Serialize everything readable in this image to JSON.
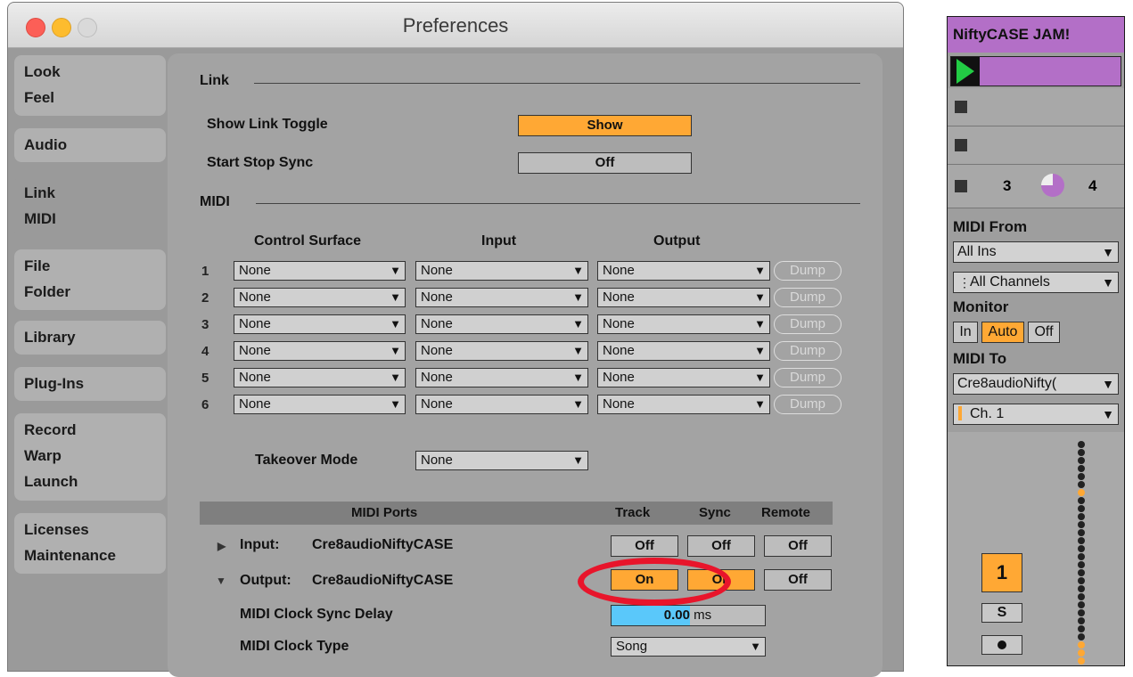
{
  "window": {
    "title": "Preferences"
  },
  "nav": [
    {
      "lines": [
        "Look",
        "Feel"
      ]
    },
    {
      "lines": [
        "Audio"
      ]
    },
    {
      "lines": [
        "Link",
        "MIDI"
      ]
    },
    {
      "lines": [
        "File",
        "Folder"
      ]
    },
    {
      "lines": [
        "Library"
      ]
    },
    {
      "lines": [
        "Plug-Ins"
      ]
    },
    {
      "lines": [
        "Record",
        "Warp",
        "Launch"
      ]
    },
    {
      "lines": [
        "Licenses",
        "Maintenance"
      ]
    }
  ],
  "link": {
    "section": "Link",
    "show_toggle_label": "Show Link Toggle",
    "show_toggle_value": "Show",
    "start_stop_label": "Start Stop Sync",
    "start_stop_value": "Off"
  },
  "midi": {
    "section": "MIDI",
    "col_control": "Control Surface",
    "col_input": "Input",
    "col_output": "Output",
    "rows": [
      {
        "n": "1",
        "cs": "None",
        "in": "None",
        "out": "None",
        "dump": "Dump"
      },
      {
        "n": "2",
        "cs": "None",
        "in": "None",
        "out": "None",
        "dump": "Dump"
      },
      {
        "n": "3",
        "cs": "None",
        "in": "None",
        "out": "None",
        "dump": "Dump"
      },
      {
        "n": "4",
        "cs": "None",
        "in": "None",
        "out": "None",
        "dump": "Dump"
      },
      {
        "n": "5",
        "cs": "None",
        "in": "None",
        "out": "None",
        "dump": "Dump"
      },
      {
        "n": "6",
        "cs": "None",
        "in": "None",
        "out": "None",
        "dump": "Dump"
      }
    ],
    "takeover_label": "Takeover Mode",
    "takeover_value": "None"
  },
  "ports": {
    "head": "MIDI Ports",
    "track": "Track",
    "sync": "Sync",
    "remote": "Remote",
    "input_label": "Input:",
    "input_name": "Cre8audioNiftyCASE",
    "input_track": "Off",
    "input_sync": "Off",
    "input_remote": "Off",
    "output_label": "Output:",
    "output_name": "Cre8audioNiftyCASE",
    "output_track": "On",
    "output_sync": "On",
    "output_remote": "Off",
    "clock_delay_label": "MIDI Clock Sync Delay",
    "clock_delay_value": "0.00",
    "clock_delay_unit": "ms",
    "clock_type_label": "MIDI Clock Type",
    "clock_type_value": "Song"
  },
  "track": {
    "name": "NiftyCASE JAM!",
    "num_a": "3",
    "num_b": "4",
    "midi_from": "MIDI From",
    "from_value": "All Ins",
    "channels_value": "All Channels",
    "monitor": "Monitor",
    "mon_in": "In",
    "mon_auto": "Auto",
    "mon_off": "Off",
    "midi_to": "MIDI To",
    "to_value": "Cre8audioNifty(",
    "ch_value": "Ch. 1",
    "track_num": "1",
    "solo": "S"
  },
  "colors": {
    "accent": "#ffa834",
    "clip": "#b36fc7",
    "highlight_ring": "#e8152b",
    "delay_field": "#5ac8fa"
  }
}
